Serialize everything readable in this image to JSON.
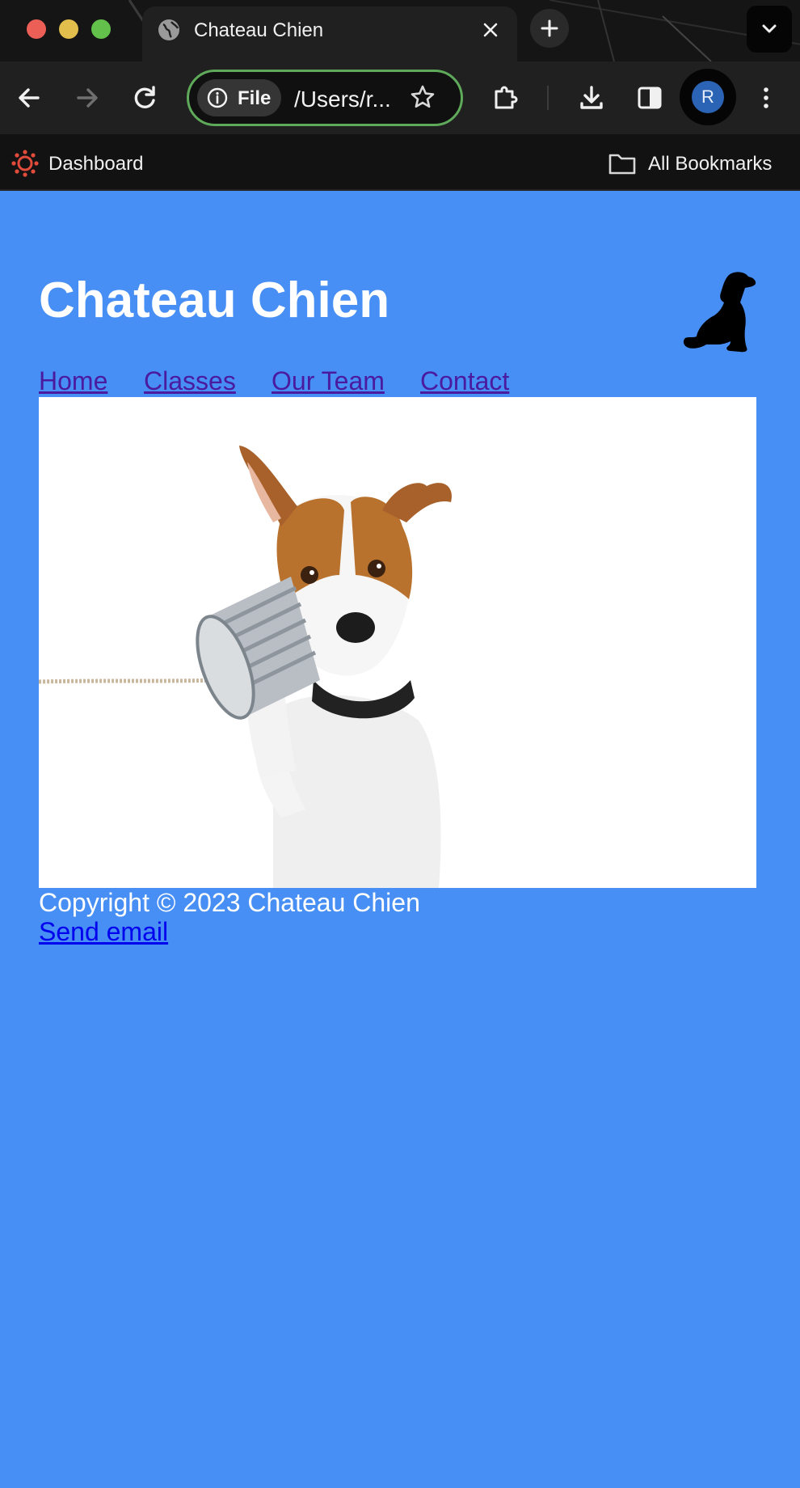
{
  "browser": {
    "tab": {
      "title": "Chateau Chien",
      "favicon": "globe-icon"
    },
    "address_bar": {
      "chip_label": "File",
      "url": "/Users/r..."
    },
    "profile_initial": "R",
    "bookmarks": {
      "left_item": "Dashboard",
      "right_item": "All Bookmarks"
    }
  },
  "site": {
    "title": "Chateau Chien",
    "logo": "dog-silhouette-icon",
    "nav": [
      "Home",
      "Classes",
      "Our Team",
      "Contact"
    ],
    "hero_image": "dog-with-tin-can-phone",
    "footer": {
      "copyright": "Copyright © 2023 Chateau Chien",
      "email_link": "Send email"
    }
  },
  "colors": {
    "page_background": "#478ff5",
    "nav_link": "#4a1a9f",
    "email_link": "#0000ee",
    "omnibox_focus": "#5faa5a"
  }
}
